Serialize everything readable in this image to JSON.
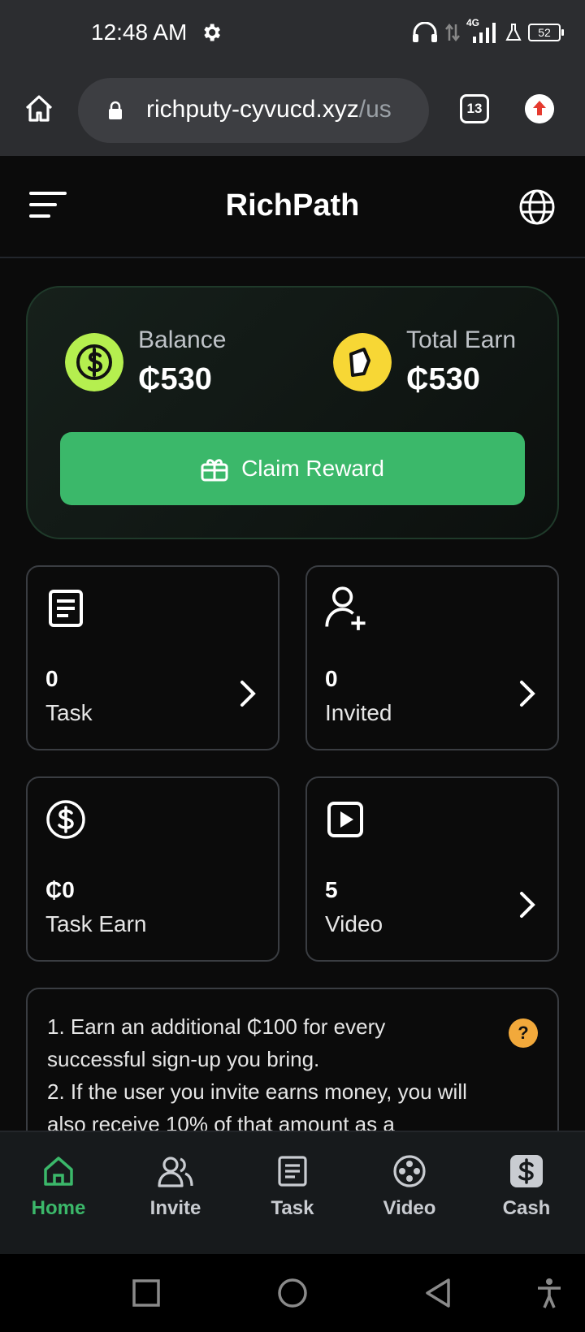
{
  "status_bar": {
    "time": "12:48 AM",
    "battery": "52",
    "network": "4G",
    "icons": [
      "gear-icon",
      "headphones-icon",
      "data-arrows-icon",
      "signal-icon",
      "flask-icon",
      "battery-icon"
    ]
  },
  "browser": {
    "url_host": "richputy-cyvucd.xyz",
    "url_path": "/us",
    "tab_count": "13",
    "icons": [
      "home-icon",
      "lock-icon",
      "update-icon"
    ]
  },
  "app": {
    "title": "RichPath",
    "icons": [
      "menu-icon",
      "globe-icon"
    ]
  },
  "balance_card": {
    "balance_label": "Balance",
    "balance_value": "₵530",
    "total_label": "Total Earn",
    "total_value": "₵530",
    "claim_label": "Claim Reward",
    "colors": {
      "balance_coin": "#b5ef4f",
      "total_coin": "#f7d735",
      "button": "#3bb86a"
    }
  },
  "stats": [
    {
      "icon": "document-icon",
      "value": "0",
      "label": "Task",
      "has_arrow": true
    },
    {
      "icon": "add-user-icon",
      "value": "0",
      "label": "Invited",
      "has_arrow": true
    },
    {
      "icon": "dollar-circle-icon",
      "value": "₵0",
      "label": "Task Earn",
      "has_arrow": false
    },
    {
      "icon": "play-icon",
      "value": "5",
      "label": "Video",
      "has_arrow": true
    }
  ],
  "info": {
    "line1": "1. Earn an additional ₵100 for every successful sign-up you bring.",
    "line2": "2. If the user you invite earns money, you will also receive 10% of that amount as a",
    "help": "?"
  },
  "bottom_nav": [
    {
      "label": "Home",
      "icon": "home-icon",
      "active": true
    },
    {
      "label": "Invite",
      "icon": "users-icon",
      "active": false
    },
    {
      "label": "Task",
      "icon": "document-icon",
      "active": false
    },
    {
      "label": "Video",
      "icon": "film-reel-icon",
      "active": false
    },
    {
      "label": "Cash",
      "icon": "dollar-icon",
      "active": false
    }
  ],
  "colors": {
    "accent": "#3bb86a",
    "background": "#0b0b0b",
    "help": "#f2a93b"
  }
}
